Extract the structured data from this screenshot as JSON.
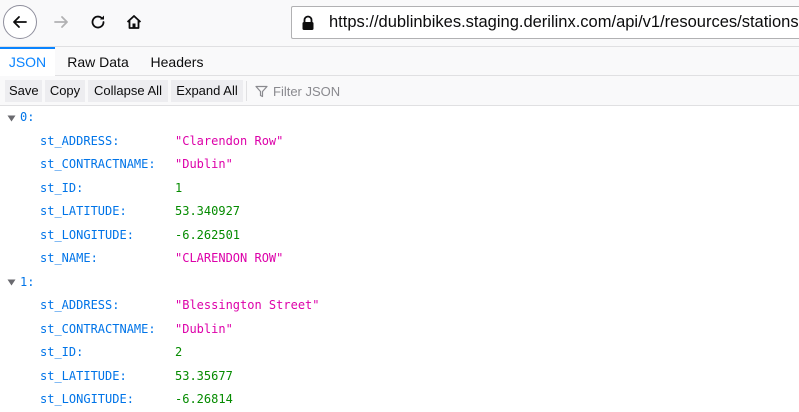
{
  "browser": {
    "url": "https://dublinbikes.staging.derilinx.com/api/v1/resources/stations",
    "icons": [
      "back-arrow-icon",
      "forward-arrow-icon",
      "reload-icon",
      "home-icon",
      "lock-icon"
    ]
  },
  "viewer": {
    "tabs": [
      "JSON",
      "Raw Data",
      "Headers"
    ],
    "active_tab": "JSON",
    "toolbar": {
      "save": "Save",
      "copy": "Copy",
      "collapse_all": "Collapse All",
      "expand_all": "Expand All",
      "filter_placeholder": "Filter JSON"
    }
  },
  "colors": {
    "key": "#0074e8",
    "string": "#dd00a9",
    "number": "#058b00",
    "active_tab": "#0a84ff"
  },
  "json": [
    {
      "index": "0:",
      "props": [
        {
          "key": "st_ADDRESS:",
          "value": "\"Clarendon Row\"",
          "type": "string"
        },
        {
          "key": "st_CONTRACTNAME:",
          "value": "\"Dublin\"",
          "type": "string"
        },
        {
          "key": "st_ID:",
          "value": "1",
          "type": "number"
        },
        {
          "key": "st_LATITUDE:",
          "value": "53.340927",
          "type": "number"
        },
        {
          "key": "st_LONGITUDE:",
          "value": "-6.262501",
          "type": "number"
        },
        {
          "key": "st_NAME:",
          "value": "\"CLARENDON ROW\"",
          "type": "string"
        }
      ]
    },
    {
      "index": "1:",
      "props": [
        {
          "key": "st_ADDRESS:",
          "value": "\"Blessington Street\"",
          "type": "string"
        },
        {
          "key": "st_CONTRACTNAME:",
          "value": "\"Dublin\"",
          "type": "string"
        },
        {
          "key": "st_ID:",
          "value": "2",
          "type": "number"
        },
        {
          "key": "st_LATITUDE:",
          "value": "53.35677",
          "type": "number"
        },
        {
          "key": "st_LONGITUDE:",
          "value": "-6.26814",
          "type": "number"
        }
      ]
    }
  ]
}
